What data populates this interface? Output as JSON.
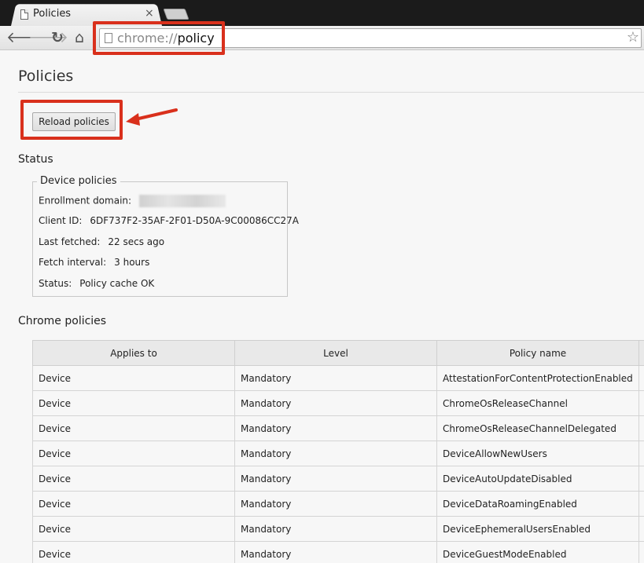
{
  "window": {
    "tab_title": "Policies",
    "tab_close": "×"
  },
  "toolbar": {
    "back_icon": "arrow-left-icon",
    "forward_icon": "arrow-right-icon",
    "reload_icon": "reload-icon",
    "home_icon": "home-icon",
    "url_scheme": "chrome://",
    "url_host": "policy",
    "bookmark_icon": "star-icon"
  },
  "page": {
    "title": "Policies",
    "reload_button": "Reload policies"
  },
  "status": {
    "heading": "Status",
    "legend": "Device policies",
    "rows": [
      {
        "label": "Enrollment domain:",
        "value": ""
      },
      {
        "label": "Client ID:",
        "value": "6DF737F2-35AF-2F01-D50A-9C00086CC27A"
      },
      {
        "label": "Last fetched:",
        "value": "22 secs ago"
      },
      {
        "label": "Fetch interval:",
        "value": "3 hours"
      },
      {
        "label": "Status:",
        "value": "Policy cache OK"
      }
    ]
  },
  "chrome_policies": {
    "heading": "Chrome policies",
    "columns": [
      "Applies to",
      "Level",
      "Policy name"
    ],
    "rows": [
      [
        "Device",
        "Mandatory",
        "AttestationForContentProtectionEnabled"
      ],
      [
        "Device",
        "Mandatory",
        "ChromeOsReleaseChannel"
      ],
      [
        "Device",
        "Mandatory",
        "ChromeOsReleaseChannelDelegated"
      ],
      [
        "Device",
        "Mandatory",
        "DeviceAllowNewUsers"
      ],
      [
        "Device",
        "Mandatory",
        "DeviceAutoUpdateDisabled"
      ],
      [
        "Device",
        "Mandatory",
        "DeviceDataRoamingEnabled"
      ],
      [
        "Device",
        "Mandatory",
        "DeviceEphemeralUsersEnabled"
      ],
      [
        "Device",
        "Mandatory",
        "DeviceGuestModeEnabled"
      ]
    ]
  },
  "colors": {
    "annotation_red": "#d9301c",
    "page_bg": "#f7f7f7"
  }
}
